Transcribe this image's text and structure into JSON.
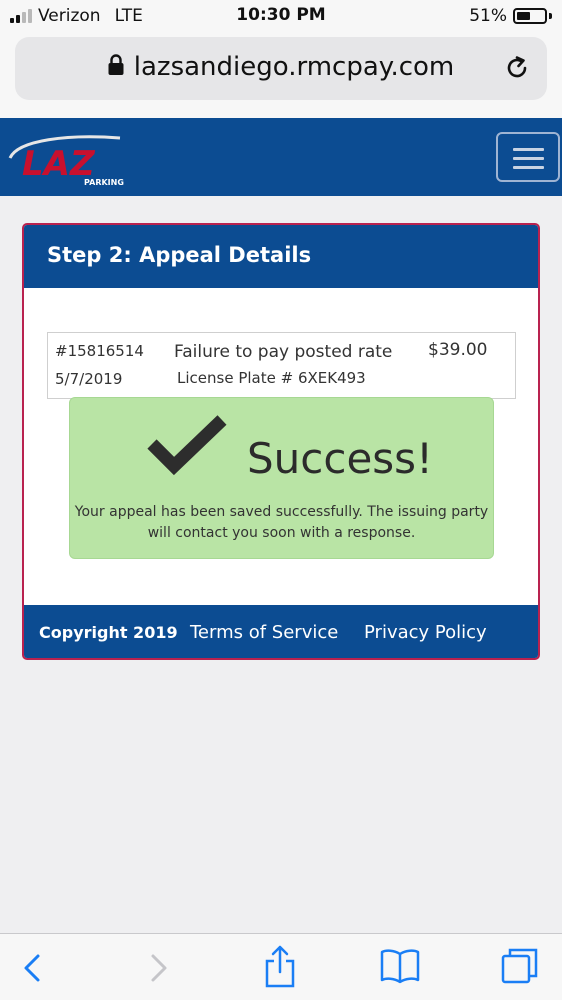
{
  "status_bar": {
    "carrier": "Verizon",
    "network": "LTE",
    "time": "10:30 PM",
    "battery_percent": "51%",
    "battery_level": 0.51,
    "signal_bars_filled": 2,
    "signal_bars_total": 4
  },
  "browser": {
    "url": "lazsandiego.rmcpay.com",
    "icons": {
      "lock": "lock-icon",
      "reload": "reload-icon",
      "back": "back-chevron-icon",
      "forward": "forward-chevron-icon",
      "share": "share-icon",
      "bookmarks": "bookmarks-icon",
      "tabs": "tabs-icon"
    }
  },
  "header": {
    "logo_text": "LAZ",
    "logo_subtext": "PARKING",
    "menu_icon": "hamburger-menu-icon"
  },
  "card": {
    "title": "Step 2: Appeal Details",
    "ticket": {
      "number": "#15816514",
      "date": "5/7/2019",
      "violation": "Failure to pay posted rate",
      "plate": "License Plate # 6XEK493",
      "amount": "$39.00"
    },
    "success": {
      "icon": "checkmark-icon",
      "title": "Success!",
      "message": "Your appeal has been saved successfully. The issuing party will contact you soon with a response."
    },
    "footer": {
      "copyright": "Copyright 2019",
      "terms": "Terms of Service",
      "privacy": "Privacy Policy"
    }
  },
  "colors": {
    "brand_blue": "#0c4c92",
    "brand_red": "#c8102e",
    "card_border": "#b9224f",
    "success_bg": "#b9e4a5",
    "ios_blue": "#1a7ef5"
  }
}
